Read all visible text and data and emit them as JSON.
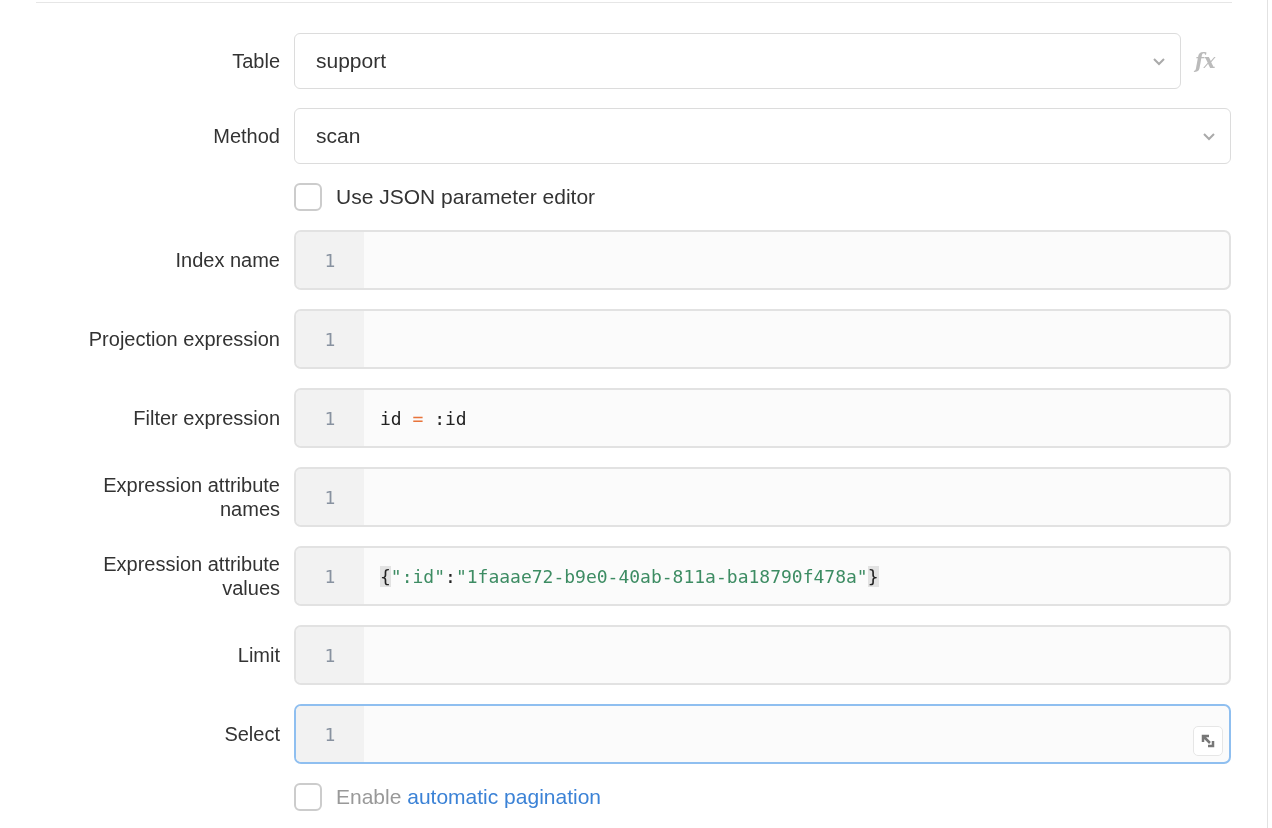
{
  "fields": [
    {
      "kind": "select",
      "label": "Table",
      "value": "support",
      "formula_button": "fx"
    },
    {
      "kind": "select",
      "label": "Method",
      "value": "scan"
    },
    {
      "kind": "checkbox",
      "text": "Use JSON parameter editor",
      "checked": false,
      "disabled": false
    },
    {
      "kind": "code",
      "label": "Index name",
      "line_number": "1",
      "focused": false
    },
    {
      "kind": "code",
      "label": "Projection expression",
      "line_number": "1",
      "focused": false
    },
    {
      "kind": "code",
      "label": "Filter expression",
      "line_number": "1",
      "focused": false,
      "tokens": [
        {
          "kind": "plain",
          "text": "id "
        },
        {
          "kind": "operator",
          "text": "="
        },
        {
          "kind": "plain",
          "text": " :id"
        }
      ]
    },
    {
      "kind": "code",
      "label": "Expression attribute names",
      "line_number": "1",
      "focused": false
    },
    {
      "kind": "code",
      "label": "Expression attribute values",
      "line_number": "1",
      "focused": false,
      "tokens": [
        {
          "kind": "bracket",
          "text": "{"
        },
        {
          "kind": "string",
          "text": "\":id\""
        },
        {
          "kind": "plain",
          "text": ":"
        },
        {
          "kind": "string",
          "text": "\"1faaae72-b9e0-40ab-811a-ba18790f478a\""
        },
        {
          "kind": "bracket",
          "text": "}"
        }
      ]
    },
    {
      "kind": "code",
      "label": "Limit",
      "line_number": "1",
      "focused": false
    },
    {
      "kind": "code",
      "label": "Select",
      "line_number": "1",
      "focused": true
    },
    {
      "kind": "checkbox",
      "text": "Enable",
      "link": "automatic pagination",
      "checked": false,
      "disabled": true
    }
  ]
}
